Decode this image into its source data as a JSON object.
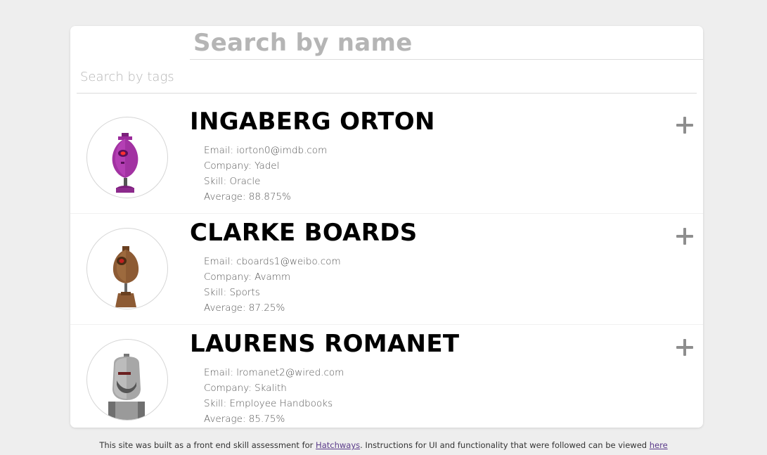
{
  "search": {
    "name_placeholder": "Search by name",
    "tags_placeholder": "Search by tags"
  },
  "students": [
    {
      "name": "INGABERG ORTON",
      "email": "Email: iorton0@imdb.com",
      "company": "Company: Yadel",
      "skill": "Skill: Oracle",
      "average": "Average: 88.875%",
      "avatar_icon": "purple-robot-icon",
      "avatar_color": "#9b2a9b"
    },
    {
      "name": "CLARKE BOARDS",
      "email": "Email: cboards1@weibo.com",
      "company": "Company: Avamm",
      "skill": "Skill: Sports",
      "average": "Average: 87.25%",
      "avatar_icon": "brown-robot-icon",
      "avatar_color": "#8a5a35"
    },
    {
      "name": "LAURENS ROMANET",
      "email": "Email: lromanet2@wired.com",
      "company": "Company: Skalith",
      "skill": "Skill: Employee Handbooks",
      "average": "Average: 85.75%",
      "avatar_icon": "gray-robot-icon",
      "avatar_color": "#9a9a9a"
    }
  ],
  "footer": {
    "text_before": "This site was built as a front end skill assessment for ",
    "link1": "Hatchways",
    "text_middle": ". Instructions for UI and functionality that were followed can be viewed ",
    "link2": "here"
  }
}
